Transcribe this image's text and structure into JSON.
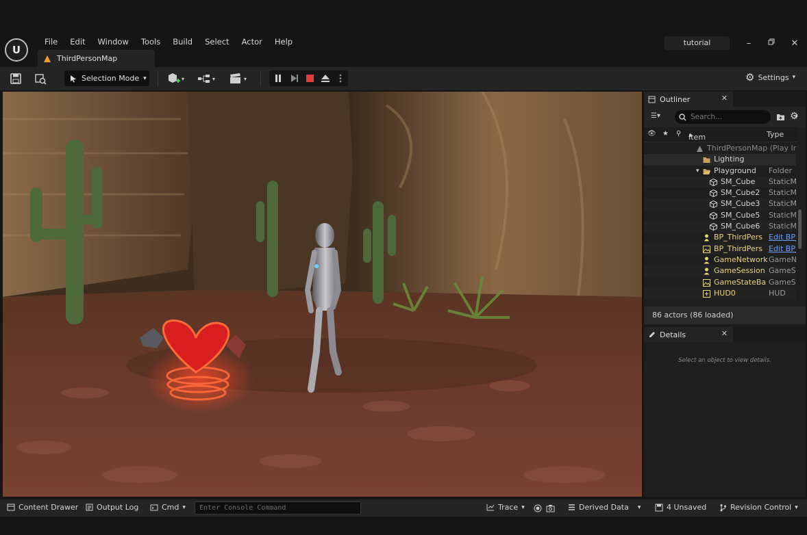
{
  "menu": [
    "File",
    "Edit",
    "Window",
    "Tools",
    "Build",
    "Select",
    "Actor",
    "Help"
  ],
  "document_tab": "ThirdPersonMap",
  "project_name": "tutorial",
  "window_controls": [
    "minimize-icon",
    "restore-icon",
    "close-icon"
  ],
  "toolbar": {
    "selection_mode": "Selection Mode",
    "settings": "Settings"
  },
  "outliner": {
    "tab_label": "Outliner",
    "search_placeholder": "Search...",
    "col_label": "Item Label",
    "col_type": "Type",
    "rows": [
      {
        "label": "ThirdPersonMap (Play In",
        "type": "",
        "indent": 96,
        "icon": "level-icon",
        "dim": true
      },
      {
        "label": "Lighting",
        "type": "",
        "indent": 106,
        "icon": "folder-icon"
      },
      {
        "label": "Playground",
        "type": "Folder",
        "indent": 106,
        "icon": "folder-open-icon"
      },
      {
        "label": "SM_Cube",
        "type": "StaticMe",
        "indent": 116,
        "icon": "static-mesh-icon"
      },
      {
        "label": "SM_Cube2",
        "type": "StaticMe",
        "indent": 116,
        "icon": "static-mesh-icon"
      },
      {
        "label": "SM_Cube3",
        "type": "StaticMe",
        "indent": 116,
        "icon": "static-mesh-icon"
      },
      {
        "label": "SM_Cube5",
        "type": "StaticMe",
        "indent": 116,
        "icon": "static-mesh-icon"
      },
      {
        "label": "SM_Cube6",
        "type": "StaticMe",
        "indent": 116,
        "icon": "static-mesh-icon"
      },
      {
        "label": "BP_ThirdPers",
        "type": "Edit BP_",
        "indent": 106,
        "icon": "pawn-icon",
        "link": true
      },
      {
        "label": "BP_ThirdPers",
        "type": "Edit BP_",
        "indent": 106,
        "icon": "picture-icon",
        "link": true
      },
      {
        "label": "GameNetwork",
        "type": "GameNe",
        "indent": 106,
        "icon": "actor-icon"
      },
      {
        "label": "GameSession",
        "type": "GameSe",
        "indent": 106,
        "icon": "actor-icon"
      },
      {
        "label": "GameStateBa",
        "type": "GameSt",
        "indent": 106,
        "icon": "picture-icon"
      },
      {
        "label": "HUD0",
        "type": "HUD",
        "indent": 106,
        "icon": "hud-icon"
      }
    ],
    "actor_count": "86 actors (86 loaded)"
  },
  "details": {
    "tab_label": "Details",
    "hint": "Select an object to view details."
  },
  "bottombar": {
    "content_drawer": "Content Drawer",
    "output_log": "Output Log",
    "cmd": "Cmd",
    "console_placeholder": "Enter Console Command",
    "trace": "Trace",
    "derived_data": "Derived Data",
    "unsaved": "4 Unsaved",
    "revision_control": "Revision Control"
  },
  "colors": {
    "accent_orange": "#f0a030",
    "stop_red": "#e03c3c",
    "link_blue": "#6aa0f0",
    "actor_yellow": "#e8d67a"
  }
}
